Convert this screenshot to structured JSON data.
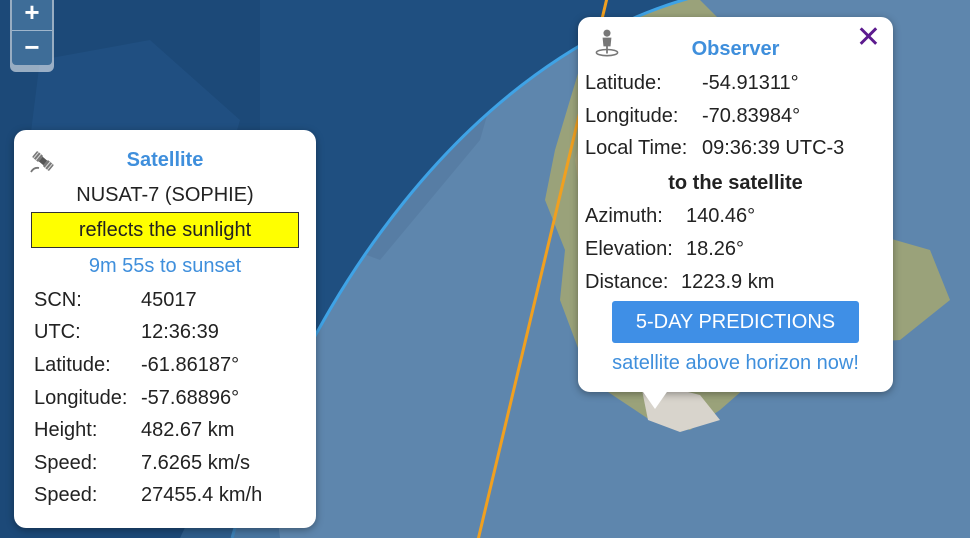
{
  "zoom": {
    "in_label": "+",
    "out_label": "−"
  },
  "satellite_popup": {
    "icon": "satellite-icon",
    "title": "Satellite",
    "name": "NUSAT-7 (SOPHIE)",
    "sunlight_status": "reflects the sunlight",
    "sunset": "9m 55s to sunset",
    "rows": [
      {
        "label": "SCN:",
        "value": "45017"
      },
      {
        "label": "UTC:",
        "value": "12:36:39"
      },
      {
        "label": "Latitude:",
        "value": "-61.86187°"
      },
      {
        "label": "Longitude:",
        "value": "-57.68896°"
      },
      {
        "label": "Height:",
        "value": "482.67 km"
      },
      {
        "label": "Speed:",
        "value": "7.6265 km/s"
      },
      {
        "label": "Speed:",
        "value": "27455.4 km/h"
      }
    ]
  },
  "observer_popup": {
    "icon": "observer-pin-icon",
    "title": "Observer",
    "close_label": "✕",
    "latitude": {
      "label": "Latitude:",
      "value": "-54.91311°"
    },
    "longitude": {
      "label": "Longitude:",
      "value": "-70.83984°"
    },
    "local_time": {
      "label": "Local Time:",
      "value": "09:36:39 UTC-3"
    },
    "heading": "to the satellite",
    "azimuth": {
      "label": "Azimuth:",
      "value": "140.46°"
    },
    "elevation": {
      "label": "Elevation:",
      "value": "18.26°"
    },
    "distance": {
      "label": "Distance:",
      "value": "1223.9 km"
    },
    "predictions_button": "5-DAY PREDICTIONS",
    "status": "satellite above horizon now!"
  },
  "colors": {
    "ocean": "#1f4f80",
    "footprint": "#5e86ad",
    "footprint_edge": "#3fa3e6",
    "ground_track": "#f0a020",
    "link": "#3f8fdc",
    "button": "#3f8fe6",
    "highlight": "#ffff00"
  }
}
